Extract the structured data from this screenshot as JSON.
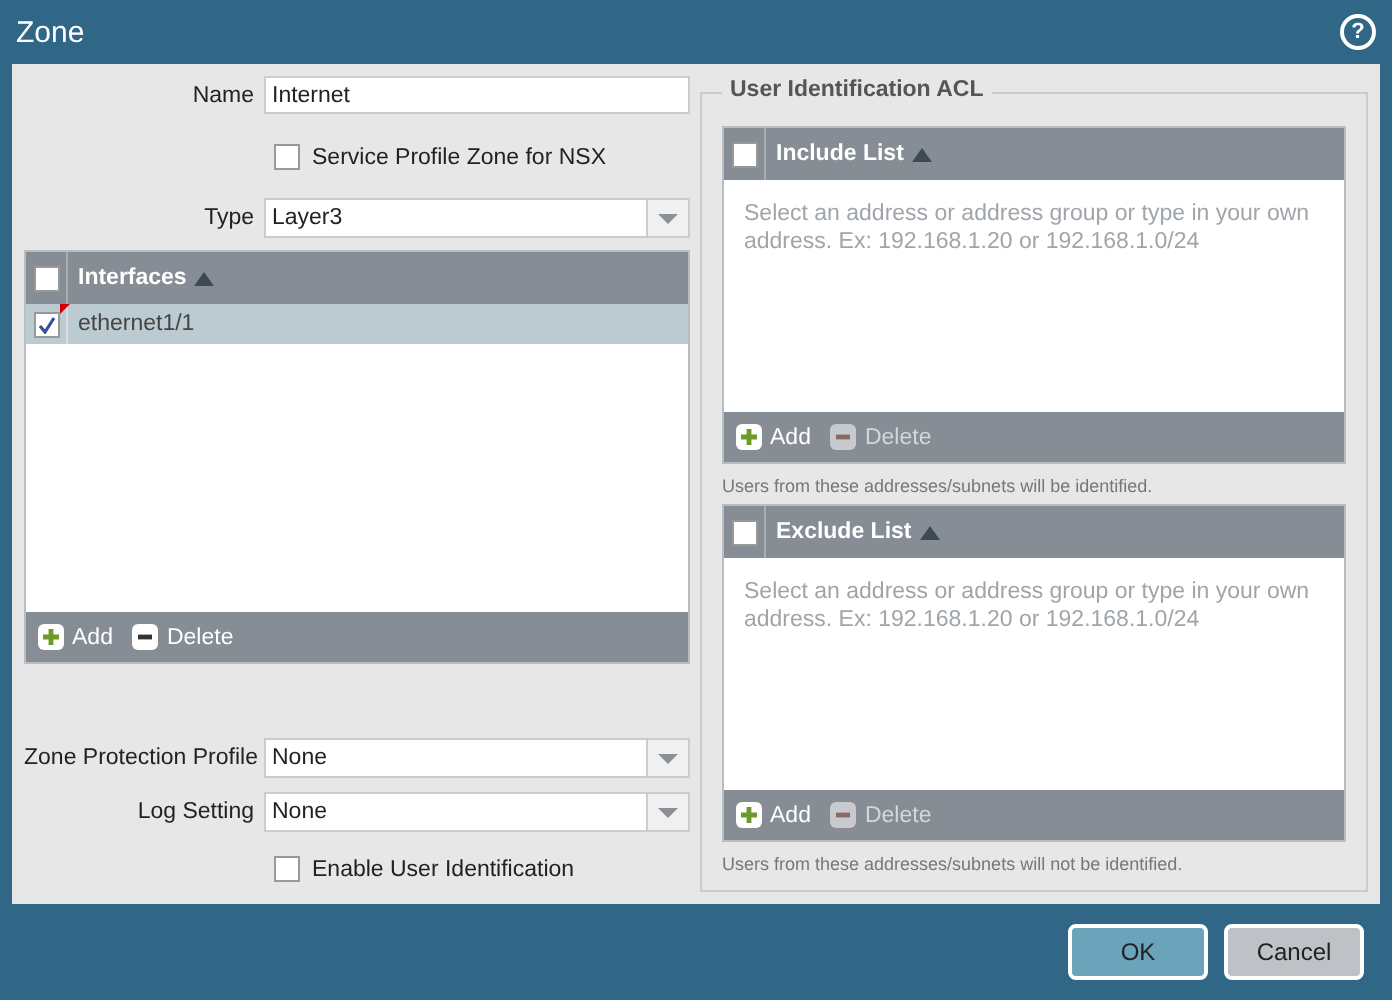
{
  "window": {
    "title": "Zone",
    "help_glyph": "?"
  },
  "name_field": {
    "label": "Name",
    "value": "Internet"
  },
  "nsx_checkbox": {
    "label": "Service Profile Zone for NSX",
    "checked": false
  },
  "type_select": {
    "label": "Type",
    "value": "Layer3"
  },
  "interfaces": {
    "header": "Interfaces",
    "header_checked": false,
    "rows": [
      {
        "name": "ethernet1/1",
        "checked": true,
        "selected": true,
        "modified": true
      }
    ],
    "actions": [
      {
        "kind": "add",
        "label": "Add",
        "disabled": false
      },
      {
        "kind": "delete",
        "label": "Delete",
        "disabled": false
      }
    ]
  },
  "zone_protection_select": {
    "label": "Zone Protection Profile",
    "value": "None"
  },
  "log_setting_select": {
    "label": "Log Setting",
    "value": "None"
  },
  "user_id_checkbox": {
    "label": "Enable User Identification",
    "checked": false
  },
  "acl": {
    "legend": "User Identification ACL",
    "lists": [
      {
        "header": "Include List",
        "header_checked": false,
        "placeholder": "Select an address or address group or type in your own address. Ex: 192.168.1.20 or 192.168.1.0/24",
        "actions": [
          {
            "kind": "add",
            "label": "Add",
            "disabled": false
          },
          {
            "kind": "delete",
            "label": "Delete",
            "disabled": true
          }
        ],
        "hint": "Users from these addresses/subnets will be identified."
      },
      {
        "header": "Exclude List",
        "header_checked": false,
        "placeholder": "Select an address or address group or type in your own address. Ex: 192.168.1.20 or 192.168.1.0/24",
        "actions": [
          {
            "kind": "add",
            "label": "Add",
            "disabled": false
          },
          {
            "kind": "delete",
            "label": "Delete",
            "disabled": true
          }
        ],
        "hint": "Users from these addresses/subnets will not be identified."
      }
    ]
  },
  "buttons": [
    {
      "label": "OK",
      "primary": true
    },
    {
      "label": "Cancel",
      "primary": false
    }
  ]
}
